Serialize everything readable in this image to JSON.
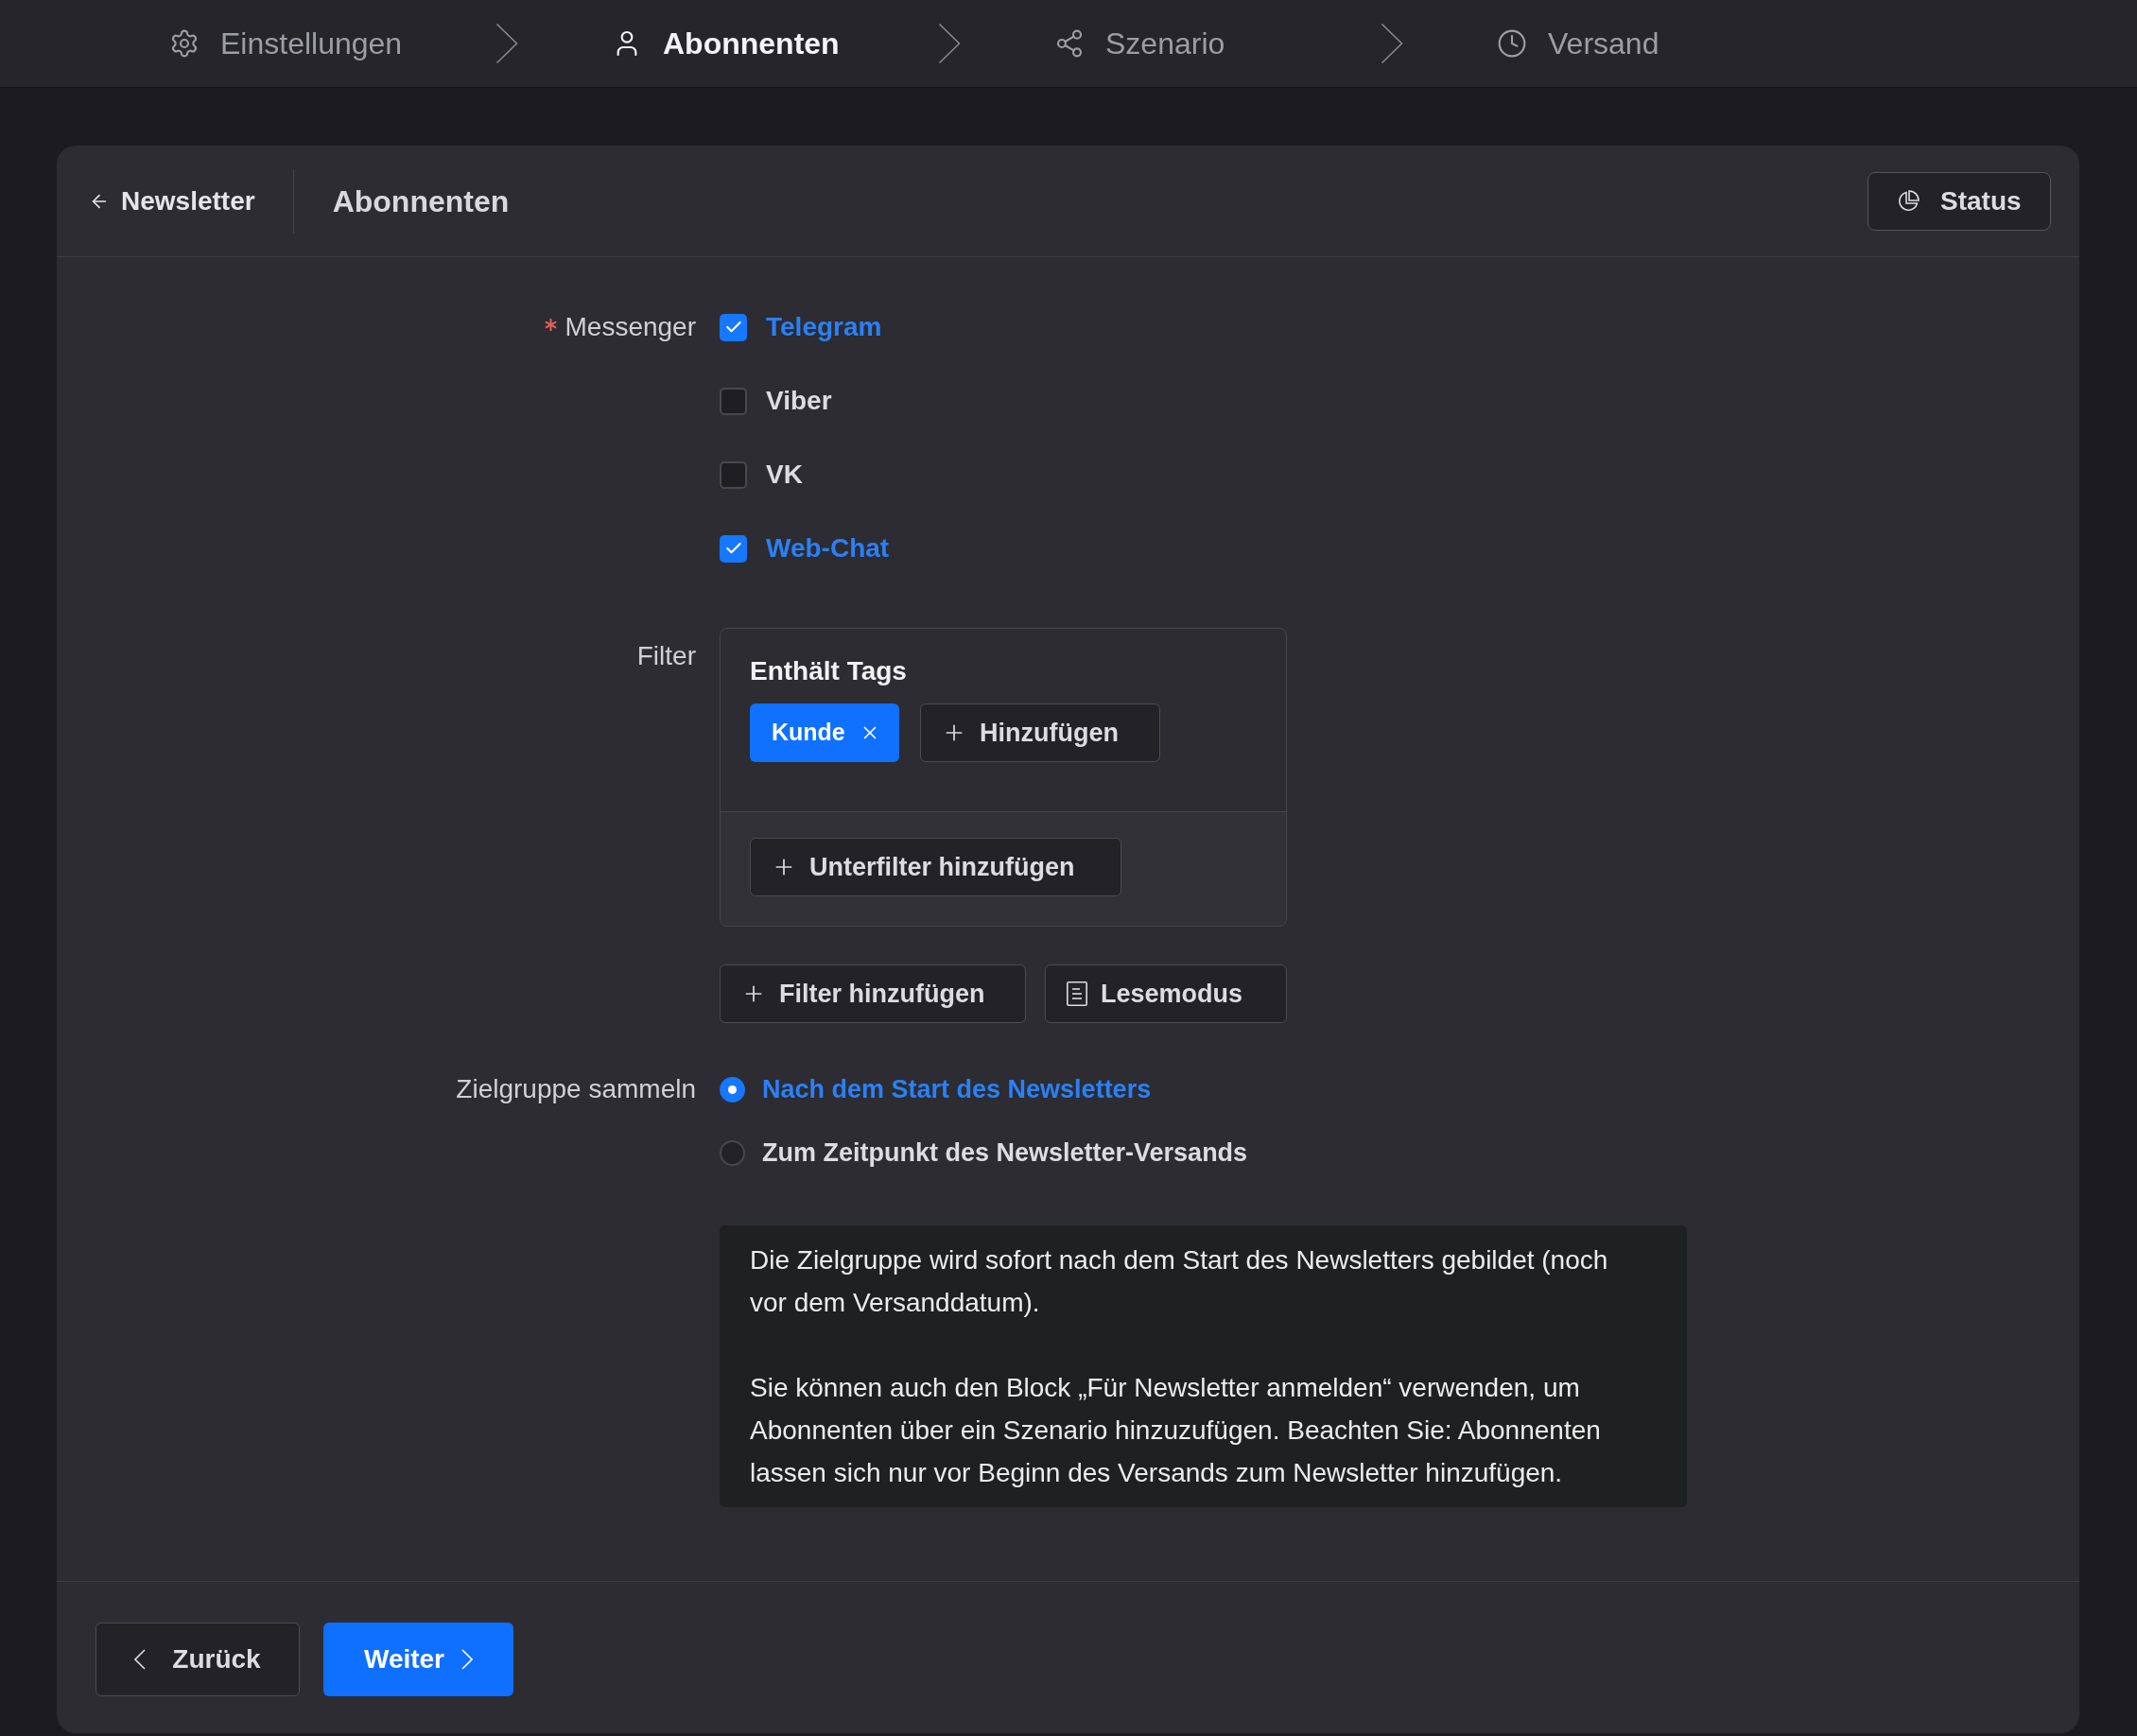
{
  "steps": [
    {
      "label": "Einstellungen",
      "kind": "gear",
      "selected": false
    },
    {
      "label": "Abonnenten",
      "kind": "user",
      "selected": true
    },
    {
      "label": "Szenario",
      "kind": "share",
      "selected": false
    },
    {
      "label": "Versand",
      "kind": "clock",
      "selected": false
    }
  ],
  "header": {
    "back_link": "Newsletter",
    "title": "Abonnenten",
    "status_button": "Status"
  },
  "messenger": {
    "label": "Messenger",
    "required": true,
    "options": [
      {
        "label": "Telegram",
        "checked": true
      },
      {
        "label": "Viber",
        "checked": false
      },
      {
        "label": "VK",
        "checked": false
      },
      {
        "label": "Web-Chat",
        "checked": true
      }
    ]
  },
  "filter": {
    "label": "Filter",
    "group": {
      "title": "Enthält Tags",
      "tags": [
        "Kunde"
      ],
      "add_button": "Hinzufügen",
      "subfilter_button": "Unterfilter hinzufügen"
    },
    "add_filter_button": "Filter hinzufügen",
    "read_mode_button": "Lesemodus"
  },
  "audience": {
    "label": "Zielgruppe sammeln",
    "options": [
      {
        "label": "Nach dem Start des Newsletters",
        "selected": true
      },
      {
        "label": "Zum Zeitpunkt des Newsletter-Versands",
        "selected": false
      }
    ],
    "info": [
      "Die Zielgruppe wird sofort nach dem Start des Newsletters gebildet (noch vor dem Versanddatum).",
      "Sie können auch den Block „Für Newsletter anmelden“ verwenden, um Abonnenten über ein Szenario hinzuzufügen. Beachten Sie: Abonnenten lassen sich nur vor Beginn des Versands zum Newsletter hinzufügen."
    ]
  },
  "footer": {
    "back_button": "Zurück",
    "next_button": "Weiter"
  }
}
